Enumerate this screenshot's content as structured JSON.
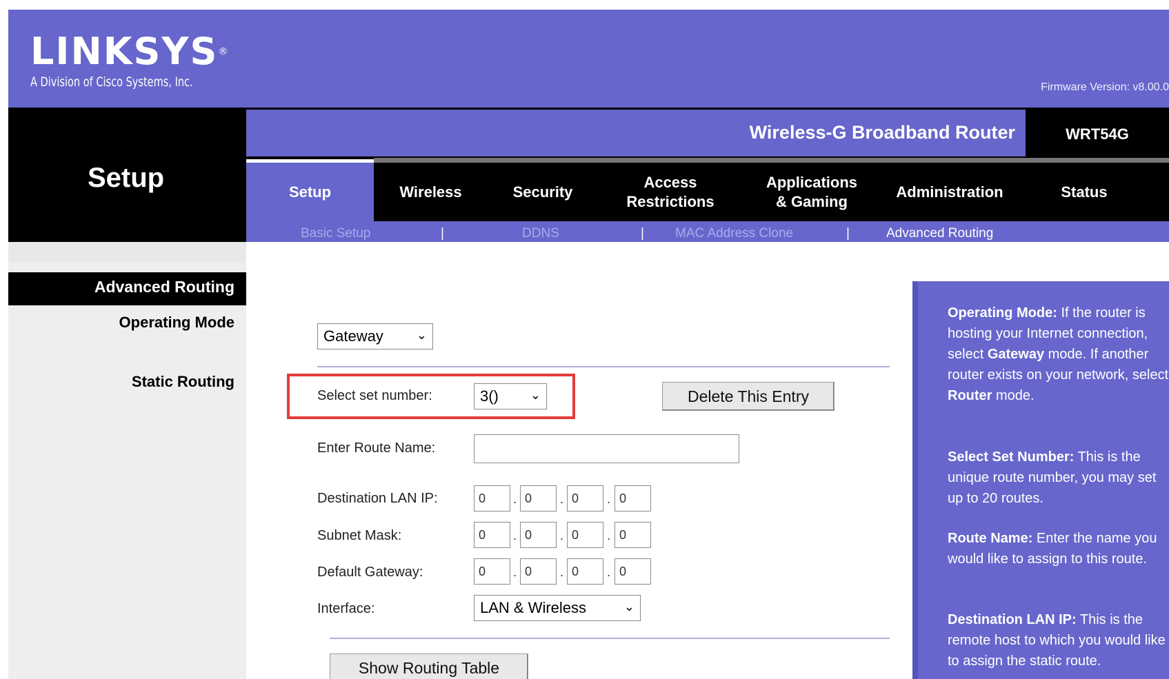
{
  "brand": {
    "logo": "LINKSYS",
    "registered": "®",
    "division": "A Division of Cisco Systems, Inc.",
    "firmware": "Firmware Version: v8.00.0"
  },
  "product": {
    "name": "Wireless-G Broadband Router",
    "model": "WRT54G"
  },
  "page_title": "Setup",
  "tabs": [
    {
      "label": "Setup"
    },
    {
      "label": "Wireless"
    },
    {
      "label": "Security"
    },
    {
      "label": "Access\nRestrictions"
    },
    {
      "label": "Applications\n& Gaming"
    },
    {
      "label": "Administration"
    },
    {
      "label": "Status"
    }
  ],
  "subtabs": [
    {
      "label": "Basic Setup"
    },
    {
      "label": "DDNS"
    },
    {
      "label": "MAC Address Clone"
    },
    {
      "label": "Advanced Routing"
    }
  ],
  "subtab_separator": "|",
  "sidebar": {
    "section": "Advanced Routing",
    "operating_mode": "Operating Mode",
    "static_routing": "Static Routing"
  },
  "form": {
    "operating_mode_value": "Gateway",
    "select_set_label": "Select set number:",
    "select_set_value": "3()",
    "delete_button": "Delete This Entry",
    "route_name_label": "Enter Route Name:",
    "route_name_value": "",
    "dest_ip_label": "Destination LAN IP:",
    "dest_ip": [
      "0",
      "0",
      "0",
      "0"
    ],
    "subnet_label": "Subnet Mask:",
    "subnet": [
      "0",
      "0",
      "0",
      "0"
    ],
    "gateway_label": "Default Gateway:",
    "gateway": [
      "0",
      "0",
      "0",
      "0"
    ],
    "interface_label": "Interface:",
    "interface_value": "LAN & Wireless",
    "show_table_button": "Show Routing Table",
    "chevron": "⌄"
  },
  "help": {
    "p1_title": "Operating Mode:",
    "p1_a": " If the router is hosting your Internet connection, select ",
    "p1_b": "Gateway",
    "p1_c": " mode. If another router exists on your network, select ",
    "p1_d": "Router",
    "p1_e": " mode.",
    "p2_title": "Select Set Number:",
    "p2_text": " This is the unique route number, you may set up to 20 routes.",
    "p3_title": "Route Name:",
    "p3_text": " Enter the name you would like to assign to this route.",
    "p4_title": "Destination LAN IP:",
    "p4_text": " This is the remote host to which you would like to assign the static route."
  },
  "colors": {
    "brand_purple": "#6666cc",
    "highlight_red": "#e33b3b"
  }
}
